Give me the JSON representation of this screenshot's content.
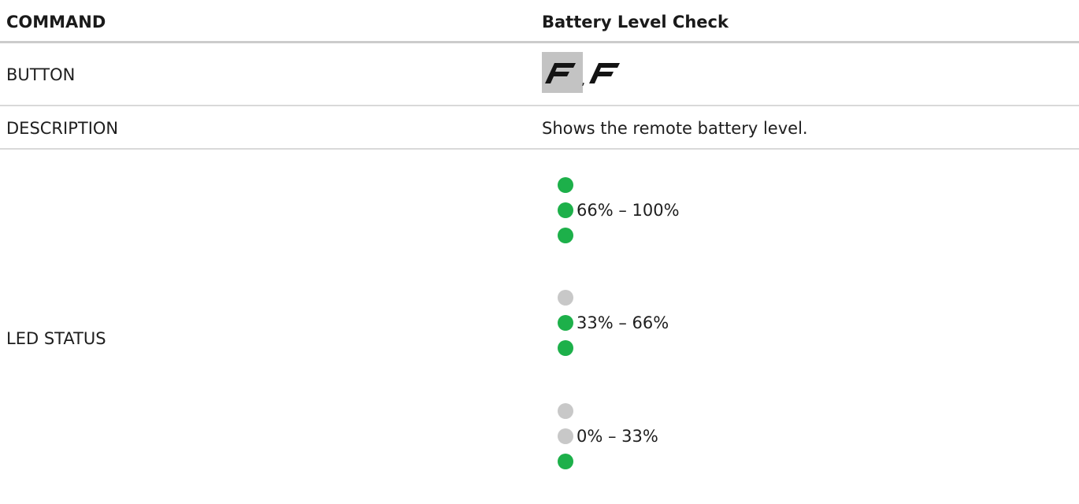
{
  "header": {
    "col1": "COMMAND",
    "col2": "Battery Level Check"
  },
  "button_row": {
    "label": "BUTTON",
    "separator": ",",
    "icons": [
      "f-button-icon",
      "f-button-icon"
    ]
  },
  "description_row": {
    "label": "DESCRIPTION",
    "text": "Shows the remote battery level."
  },
  "led_row": {
    "label": "LED STATUS",
    "levels": [
      {
        "range": "66% – 100%",
        "leds": [
          "on",
          "on",
          "on"
        ]
      },
      {
        "range": "33% – 66%",
        "leds": [
          "off",
          "on",
          "on"
        ]
      },
      {
        "range": "0% – 33%",
        "leds": [
          "off",
          "off",
          "on"
        ]
      }
    ]
  },
  "colors": {
    "led_on": "#1db04a",
    "led_off": "#c8c8c8",
    "header_rule": "#cccccc",
    "row_rule": "#d9d9d9",
    "icon_highlight": "#c3c3c3"
  }
}
